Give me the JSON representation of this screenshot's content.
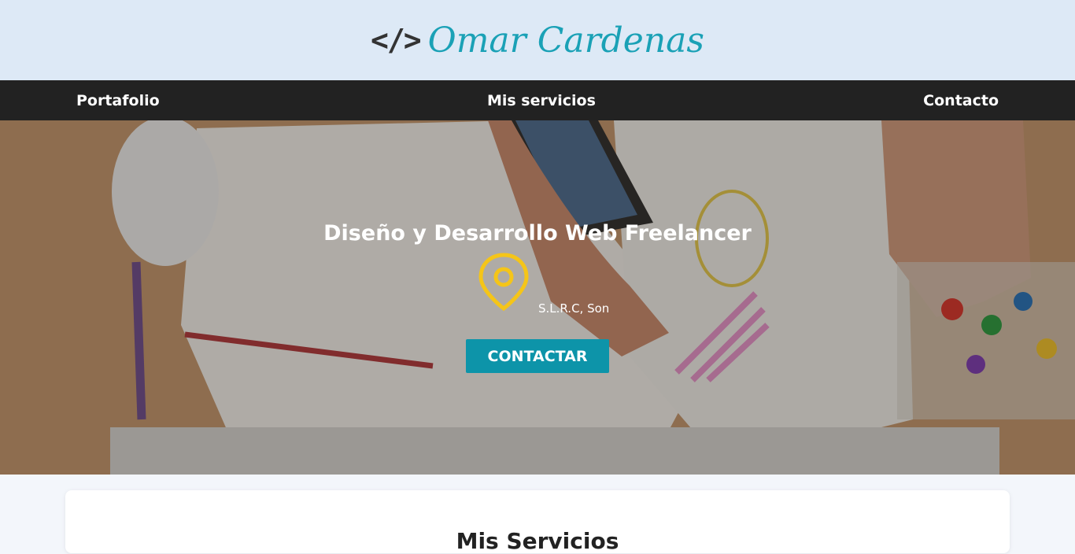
{
  "header": {
    "logo_symbol": "</>",
    "logo_text": "Omar Cardenas"
  },
  "nav": {
    "items": [
      "Portafolio",
      "Mis servicios",
      "Contacto"
    ]
  },
  "hero": {
    "title": "Diseño y Desarrollo Web Freelancer",
    "location": "S.L.R.C, Son",
    "cta_label": "CONTACTAR",
    "pin_icon": "map-pin-icon"
  },
  "section": {
    "title": "Mis Servicios"
  },
  "colors": {
    "brand": "#1aa1b6",
    "cta": "#0d94a9",
    "nav_bg": "#222222",
    "header_bg": "#dde9f6",
    "pin": "#f5c518"
  }
}
